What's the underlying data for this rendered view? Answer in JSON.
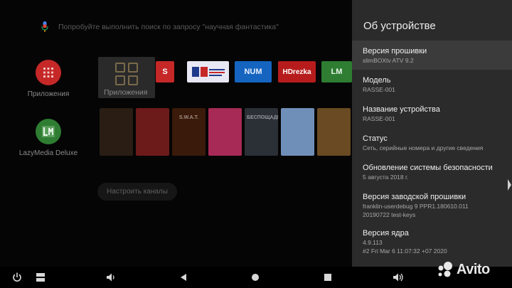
{
  "search": {
    "placeholder_text": "Попробуйте выполнить поиск по запросу \"научная фантастика\"",
    "icon": "mic-icon"
  },
  "sidebar_apps": [
    {
      "label": "Приложения",
      "icon": "apps-grid-icon",
      "color": "#c62828"
    },
    {
      "label": "LazyMedia Deluxe",
      "icon": "lazymedia-logo-icon",
      "color": "#2e7d32"
    }
  ],
  "apps_row": {
    "label": "Приложения"
  },
  "channel_tiles": [
    {
      "label": "S",
      "color": "#c62828"
    },
    {
      "label": "",
      "color": "#e8e8f5"
    },
    {
      "label": "NUM",
      "color": "#1565c0"
    },
    {
      "label": "HDrezka",
      "color": "#b71c1c"
    },
    {
      "label": "LM",
      "color": "#2e7d32"
    }
  ],
  "posters": [
    {
      "color": "#2a1e14",
      "text": ""
    },
    {
      "color": "#6d1a1a",
      "text": ""
    },
    {
      "color": "#3a1a0a",
      "text": "S.W.A.T."
    },
    {
      "color": "#a62a55",
      "text": ""
    },
    {
      "color": "#2b2f36",
      "text": "БЕСПОЩАДНЫЙ"
    },
    {
      "color": "#6f8fb8",
      "text": ""
    },
    {
      "color": "#6a4a22",
      "text": ""
    },
    {
      "color": "#bfb9b0",
      "text": ""
    }
  ],
  "channels_button": {
    "label": "Настроить каналы"
  },
  "settings_panel": {
    "title": "Об устройстве",
    "items": [
      {
        "title": "Версия прошивки",
        "subtitle": "slimBOXtv ATV 9.2",
        "subtitle2": ""
      },
      {
        "title": "Модель",
        "subtitle": "RASSE-001",
        "subtitle2": ""
      },
      {
        "title": "Название устройства",
        "subtitle": "RASSE-001",
        "subtitle2": ""
      },
      {
        "title": "Статус",
        "subtitle": "Сеть, серийные номера и другие сведения",
        "subtitle2": ""
      },
      {
        "title": "Обновление системы безопасности",
        "subtitle": "5 августа 2018 г.",
        "subtitle2": ""
      },
      {
        "title": "Версия заводской прошивки",
        "subtitle": "franklin-userdebug 9 PPR1.180610.011",
        "subtitle2": "20190722 test-keys"
      },
      {
        "title": "Версия ядра",
        "subtitle": "4.9.113",
        "subtitle2": "#2 Fri Mar 6 11:07:32 +07 2020"
      }
    ]
  },
  "navbar": {
    "icons": [
      "power-icon",
      "recents-icon",
      "volume-icon",
      "back-icon",
      "home-icon",
      "overview-icon",
      "volume-icon"
    ]
  },
  "watermark": {
    "label": "Avito",
    "icon": "avito-dots-icon"
  }
}
